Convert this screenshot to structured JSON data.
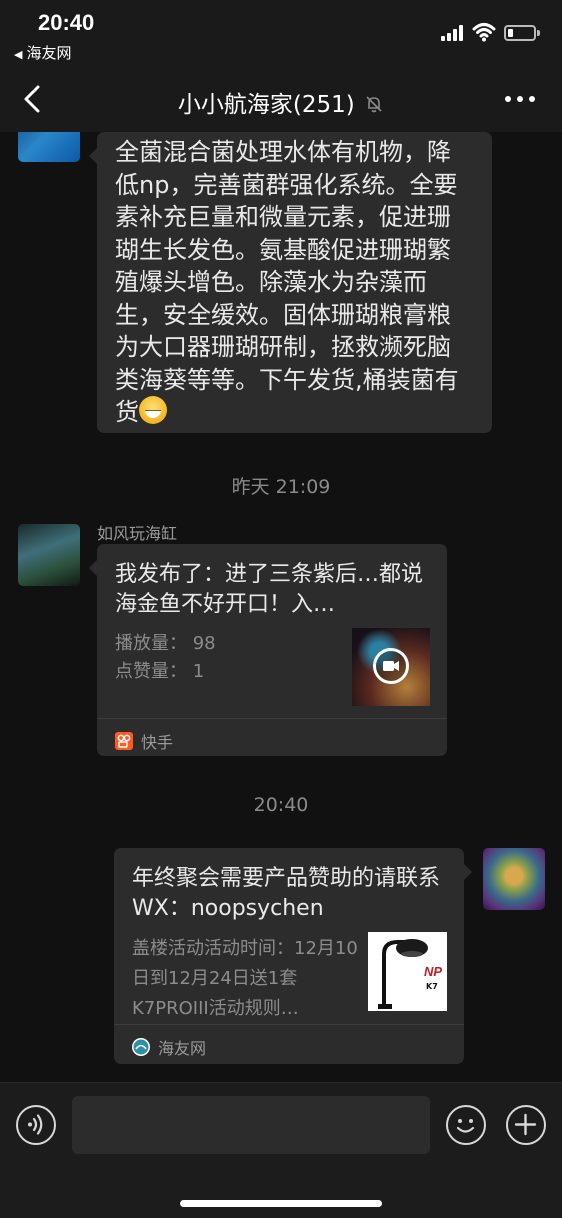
{
  "status_bar": {
    "time": "20:40",
    "back_app": "海友网",
    "battery_level": 0.2
  },
  "nav": {
    "title": "小小航海家(251)"
  },
  "messages": {
    "top_text": "全菌混合菌处理水体有机物，降低np，完善菌群强化系统。全要素补充巨量和微量元素，促进珊瑚生长发色。氨基酸促进珊瑚繁殖爆头增色。除藻水为杂藻而生，安全缓效。固体珊瑚粮膏粮为大口器珊瑚研制，拯救濒死脑类海葵等等。下午发货,桶装菌有货",
    "timestamp_1": "昨天 21:09",
    "sender_1": "如风玩海缸",
    "kuaishou_card": {
      "title": "我发布了：进了三条紫后…都说海金鱼不好开口！入…",
      "plays": "播放量：  98",
      "likes": "点赞量：  1",
      "source": "快手"
    },
    "timestamp_2": "20:40",
    "haiyou_card": {
      "title": "年终聚会需要产品赞助的请联系 WX：noopsychen",
      "desc": "盖楼活动活动时间：12月10日到12月24日送1套K7PROIII活动规则…",
      "thumb_logo": "NP",
      "thumb_model": "K7",
      "source": "海友网"
    }
  },
  "icons": {
    "status_back": "back-triangle-icon",
    "signal": "signal-icon",
    "wifi": "wifi-icon",
    "battery": "battery-icon",
    "nav_back": "chevron-left-icon",
    "mute": "bell-muted-icon",
    "more": "more-dots-icon",
    "voice": "voice-icon",
    "emoji": "emoji-icon",
    "plus": "plus-icon",
    "kuaishou": "kuaishou-logo-icon",
    "haiyou": "haiyou-logo-icon",
    "play": "play-video-icon"
  },
  "colors": {
    "background": "#111111",
    "bubble": "#2c2c2c",
    "kuaishou_orange": "#ff5a1f"
  }
}
